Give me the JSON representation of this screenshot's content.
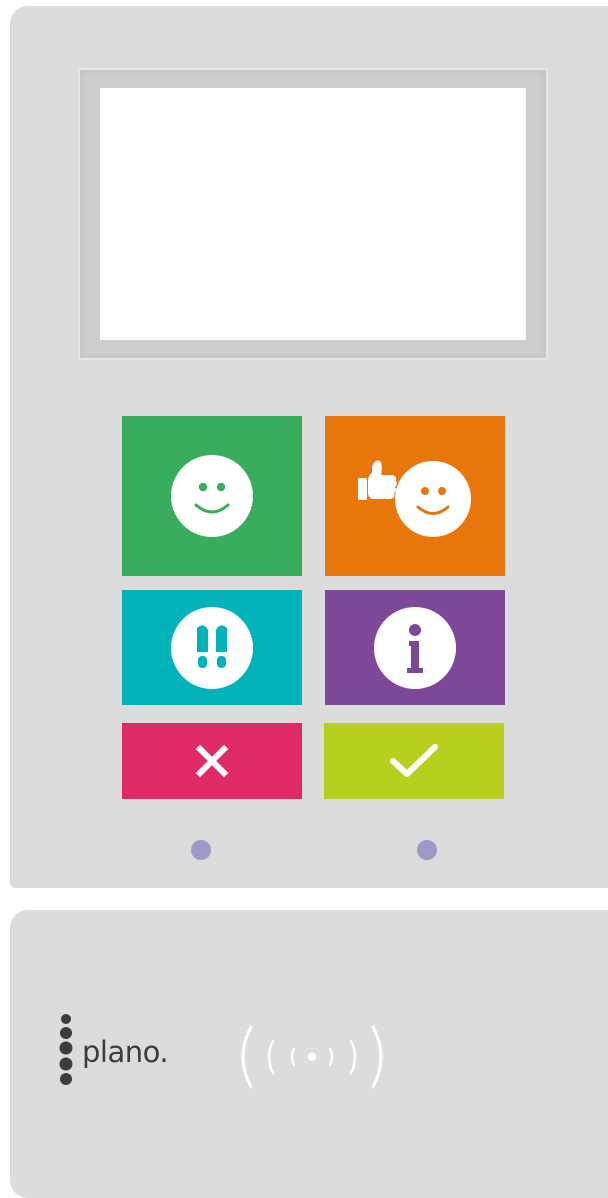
{
  "device": {
    "body_color": "#dcdcdc",
    "screen_color": "#ffffff"
  },
  "buttons": [
    {
      "id": "smiley",
      "color": "#3aac5d",
      "icon": "smiley-icon"
    },
    {
      "id": "thumbs-up-smiley",
      "color": "#e8760a",
      "icon": "thumbs-up-smiley-icon"
    },
    {
      "id": "footprints",
      "color": "#00b3b8",
      "icon": "footprints-icon"
    },
    {
      "id": "info",
      "color": "#7d4898",
      "icon": "info-icon"
    },
    {
      "id": "cancel",
      "color": "#e02a66",
      "icon": "cross-icon"
    },
    {
      "id": "confirm",
      "color": "#b9cf1e",
      "icon": "check-icon"
    }
  ],
  "leds": {
    "color": "#9e9ac8",
    "count": 2
  },
  "brand": {
    "logo_text": "plano.",
    "nfc_icon": "nfc-contactless-icon"
  }
}
